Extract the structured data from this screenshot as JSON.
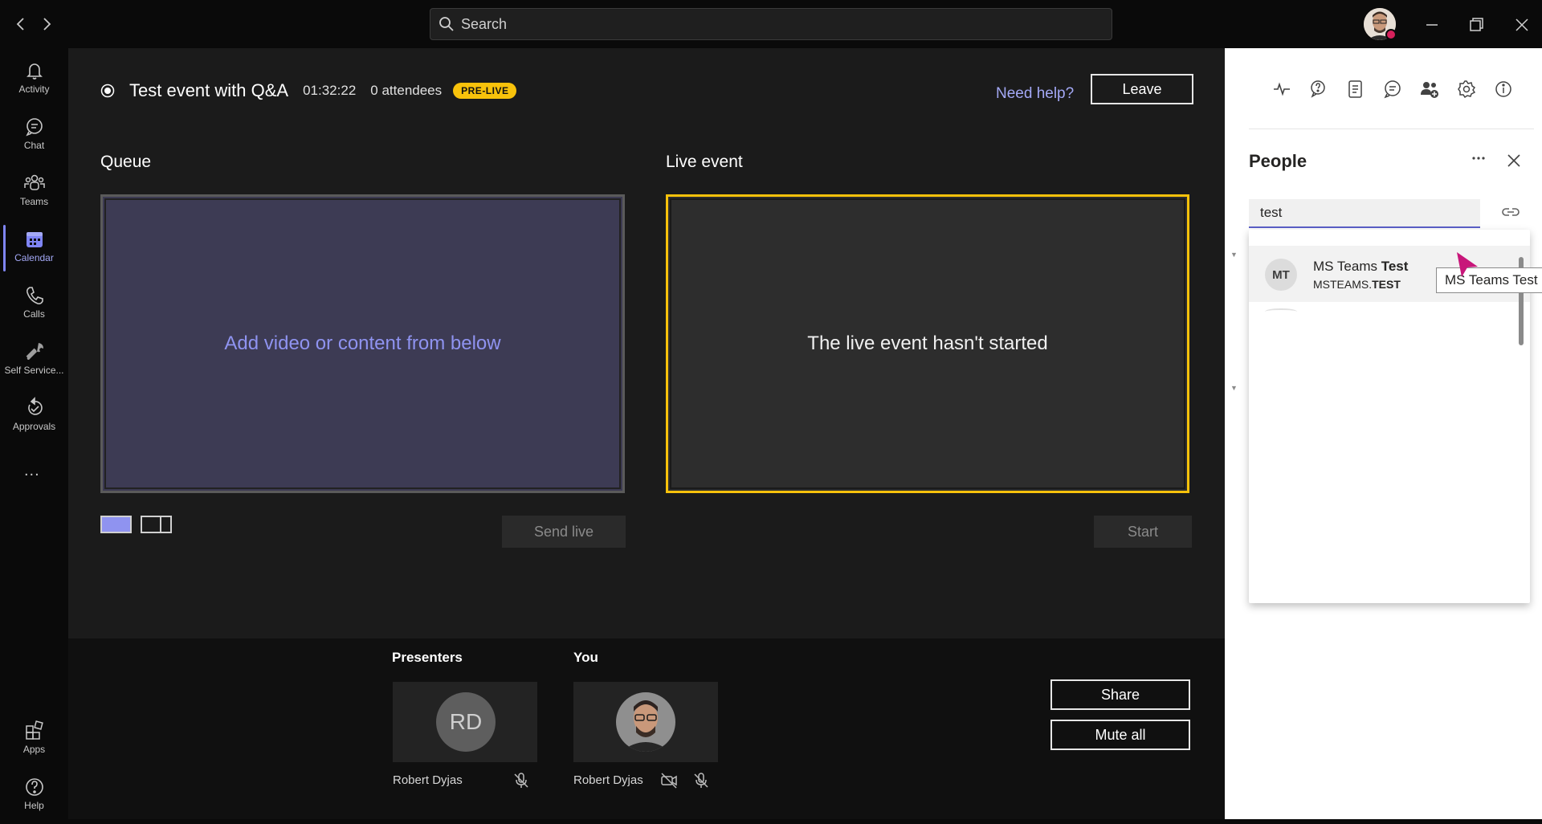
{
  "titlebar": {
    "search_placeholder": "Search"
  },
  "rail": {
    "items": [
      {
        "label": "Activity",
        "icon": "bell-icon"
      },
      {
        "label": "Chat",
        "icon": "chat-icon"
      },
      {
        "label": "Teams",
        "icon": "teams-icon"
      },
      {
        "label": "Calendar",
        "icon": "calendar-icon",
        "active": true
      },
      {
        "label": "Calls",
        "icon": "phone-icon"
      },
      {
        "label": "Self Service...",
        "icon": "wrench-icon"
      },
      {
        "label": "Approvals",
        "icon": "approvals-icon"
      }
    ],
    "more": "...",
    "bottom_items": [
      {
        "label": "Apps",
        "icon": "apps-icon"
      },
      {
        "label": "Help",
        "icon": "help-icon"
      }
    ]
  },
  "event": {
    "title": "Test event with Q&A",
    "elapsed": "01:32:22",
    "attendees": "0 attendees",
    "status_badge": "PRE-LIVE",
    "need_help": "Need help?",
    "leave_label": "Leave"
  },
  "queue": {
    "heading": "Queue",
    "placeholder": "Add video or content from below",
    "send_live_label": "Send live"
  },
  "live": {
    "heading": "Live event",
    "message": "The live event hasn't started",
    "start_label": "Start"
  },
  "bottom": {
    "presenters_heading": "Presenters",
    "you_heading": "You",
    "presenter": {
      "initials": "RD",
      "name": "Robert Dyjas"
    },
    "you": {
      "name": "Robert Dyjas"
    },
    "share_label": "Share",
    "mute_all_label": "Mute all"
  },
  "people_panel": {
    "title": "People",
    "search_value": "test",
    "result": {
      "initials": "MT",
      "name_plain": "MS Teams ",
      "name_bold": "Test",
      "email_plain": "MSTEAMS.",
      "email_bold": "TEST"
    },
    "tooltip": "MS Teams Test"
  },
  "colors": {
    "accent": "#7f85f5",
    "live_border": "#f8c20b",
    "badge_bg": "#f8c20b",
    "status_busy": "#d6215b"
  }
}
